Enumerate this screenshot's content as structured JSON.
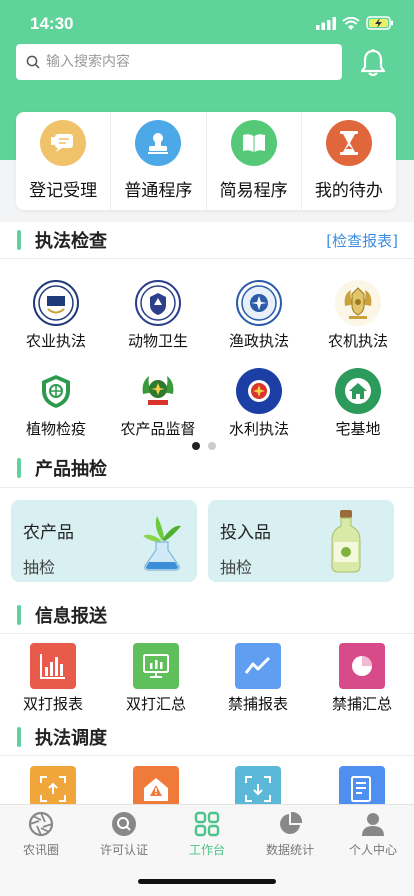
{
  "status": {
    "time": "14:30"
  },
  "search": {
    "placeholder": "输入搜索内容"
  },
  "quick_actions": [
    {
      "label": "登记受理",
      "icon": "form-icon",
      "color": "#f0c36a"
    },
    {
      "label": "普通程序",
      "icon": "stamp-icon",
      "color": "#4da8e8"
    },
    {
      "label": "简易程序",
      "icon": "book-icon",
      "color": "#55c978"
    },
    {
      "label": "我的待办",
      "icon": "hourglass-icon",
      "color": "#e0663c"
    }
  ],
  "enforcement": {
    "title": "执法检查",
    "link": "[检查报表]",
    "items": [
      {
        "label": "农业执法",
        "icon": "agri-law-emblem-icon"
      },
      {
        "label": "动物卫生",
        "icon": "animal-health-emblem-icon"
      },
      {
        "label": "渔政执法",
        "icon": "fishery-emblem-icon"
      },
      {
        "label": "农机执法",
        "icon": "agri-machinery-emblem-icon"
      },
      {
        "label": "植物检疫",
        "icon": "plant-quarantine-emblem-icon"
      },
      {
        "label": "农产品监督",
        "icon": "produce-supervision-emblem-icon"
      },
      {
        "label": "水利执法",
        "icon": "water-law-emblem-icon"
      },
      {
        "label": "宅基地",
        "icon": "homestead-emblem-icon"
      }
    ],
    "page_current": 1,
    "page_total": 2
  },
  "sampling": {
    "title": "产品抽检",
    "cards": [
      {
        "title": "农产品",
        "sub": "抽检",
        "icon": "flask-plant-icon"
      },
      {
        "title": "投入品",
        "sub": "抽检",
        "icon": "jar-icon"
      }
    ]
  },
  "reporting": {
    "title": "信息报送",
    "items": [
      {
        "label": "双打报表",
        "icon": "bar-chart-icon",
        "color": "#e85a4a"
      },
      {
        "label": "双打汇总",
        "icon": "monitor-chart-icon",
        "color": "#5fbf5a"
      },
      {
        "label": "禁捕报表",
        "icon": "line-chart-icon",
        "color": "#5f9ef0"
      },
      {
        "label": "禁捕汇总",
        "icon": "pie-chart-icon",
        "color": "#d84b8a"
      }
    ]
  },
  "dispatch": {
    "title": "执法调度",
    "items": [
      {
        "icon": "scan-upload-icon",
        "color": "#f0a63a"
      },
      {
        "icon": "house-alert-icon",
        "color": "#f07a3a"
      },
      {
        "icon": "scan-download-icon",
        "color": "#5bb8d8"
      },
      {
        "icon": "document-icon",
        "color": "#4f8ff0"
      }
    ]
  },
  "tabbar": {
    "tabs": [
      {
        "label": "农讯圈",
        "icon": "aperture-icon",
        "active": false
      },
      {
        "label": "许可认证",
        "icon": "search-circle-icon",
        "active": false
      },
      {
        "label": "工作台",
        "icon": "grid-icon",
        "active": true
      },
      {
        "label": "数据统计",
        "icon": "pie-icon",
        "active": false
      },
      {
        "label": "个人中心",
        "icon": "person-icon",
        "active": false
      }
    ]
  }
}
